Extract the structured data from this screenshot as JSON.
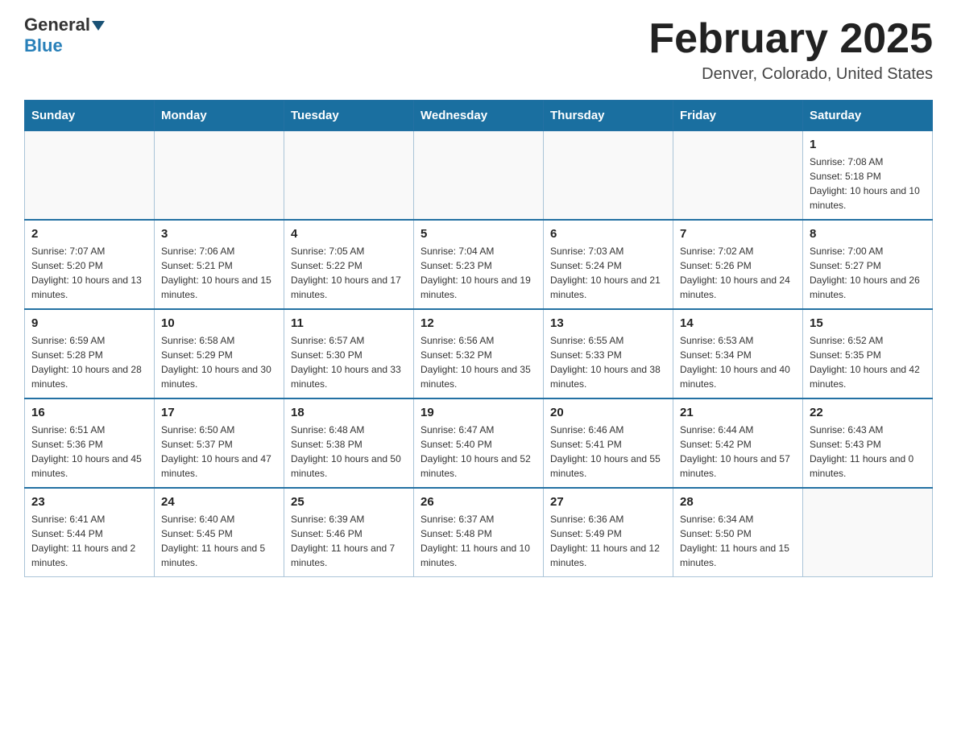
{
  "header": {
    "logo_line1": "General",
    "logo_line2": "Blue",
    "title": "February 2025",
    "subtitle": "Denver, Colorado, United States"
  },
  "days_of_week": [
    "Sunday",
    "Monday",
    "Tuesday",
    "Wednesday",
    "Thursday",
    "Friday",
    "Saturday"
  ],
  "weeks": [
    [
      {
        "day": "",
        "sunrise": "",
        "sunset": "",
        "daylight": ""
      },
      {
        "day": "",
        "sunrise": "",
        "sunset": "",
        "daylight": ""
      },
      {
        "day": "",
        "sunrise": "",
        "sunset": "",
        "daylight": ""
      },
      {
        "day": "",
        "sunrise": "",
        "sunset": "",
        "daylight": ""
      },
      {
        "day": "",
        "sunrise": "",
        "sunset": "",
        "daylight": ""
      },
      {
        "day": "",
        "sunrise": "",
        "sunset": "",
        "daylight": ""
      },
      {
        "day": "1",
        "sunrise": "Sunrise: 7:08 AM",
        "sunset": "Sunset: 5:18 PM",
        "daylight": "Daylight: 10 hours and 10 minutes."
      }
    ],
    [
      {
        "day": "2",
        "sunrise": "Sunrise: 7:07 AM",
        "sunset": "Sunset: 5:20 PM",
        "daylight": "Daylight: 10 hours and 13 minutes."
      },
      {
        "day": "3",
        "sunrise": "Sunrise: 7:06 AM",
        "sunset": "Sunset: 5:21 PM",
        "daylight": "Daylight: 10 hours and 15 minutes."
      },
      {
        "day": "4",
        "sunrise": "Sunrise: 7:05 AM",
        "sunset": "Sunset: 5:22 PM",
        "daylight": "Daylight: 10 hours and 17 minutes."
      },
      {
        "day": "5",
        "sunrise": "Sunrise: 7:04 AM",
        "sunset": "Sunset: 5:23 PM",
        "daylight": "Daylight: 10 hours and 19 minutes."
      },
      {
        "day": "6",
        "sunrise": "Sunrise: 7:03 AM",
        "sunset": "Sunset: 5:24 PM",
        "daylight": "Daylight: 10 hours and 21 minutes."
      },
      {
        "day": "7",
        "sunrise": "Sunrise: 7:02 AM",
        "sunset": "Sunset: 5:26 PM",
        "daylight": "Daylight: 10 hours and 24 minutes."
      },
      {
        "day": "8",
        "sunrise": "Sunrise: 7:00 AM",
        "sunset": "Sunset: 5:27 PM",
        "daylight": "Daylight: 10 hours and 26 minutes."
      }
    ],
    [
      {
        "day": "9",
        "sunrise": "Sunrise: 6:59 AM",
        "sunset": "Sunset: 5:28 PM",
        "daylight": "Daylight: 10 hours and 28 minutes."
      },
      {
        "day": "10",
        "sunrise": "Sunrise: 6:58 AM",
        "sunset": "Sunset: 5:29 PM",
        "daylight": "Daylight: 10 hours and 30 minutes."
      },
      {
        "day": "11",
        "sunrise": "Sunrise: 6:57 AM",
        "sunset": "Sunset: 5:30 PM",
        "daylight": "Daylight: 10 hours and 33 minutes."
      },
      {
        "day": "12",
        "sunrise": "Sunrise: 6:56 AM",
        "sunset": "Sunset: 5:32 PM",
        "daylight": "Daylight: 10 hours and 35 minutes."
      },
      {
        "day": "13",
        "sunrise": "Sunrise: 6:55 AM",
        "sunset": "Sunset: 5:33 PM",
        "daylight": "Daylight: 10 hours and 38 minutes."
      },
      {
        "day": "14",
        "sunrise": "Sunrise: 6:53 AM",
        "sunset": "Sunset: 5:34 PM",
        "daylight": "Daylight: 10 hours and 40 minutes."
      },
      {
        "day": "15",
        "sunrise": "Sunrise: 6:52 AM",
        "sunset": "Sunset: 5:35 PM",
        "daylight": "Daylight: 10 hours and 42 minutes."
      }
    ],
    [
      {
        "day": "16",
        "sunrise": "Sunrise: 6:51 AM",
        "sunset": "Sunset: 5:36 PM",
        "daylight": "Daylight: 10 hours and 45 minutes."
      },
      {
        "day": "17",
        "sunrise": "Sunrise: 6:50 AM",
        "sunset": "Sunset: 5:37 PM",
        "daylight": "Daylight: 10 hours and 47 minutes."
      },
      {
        "day": "18",
        "sunrise": "Sunrise: 6:48 AM",
        "sunset": "Sunset: 5:38 PM",
        "daylight": "Daylight: 10 hours and 50 minutes."
      },
      {
        "day": "19",
        "sunrise": "Sunrise: 6:47 AM",
        "sunset": "Sunset: 5:40 PM",
        "daylight": "Daylight: 10 hours and 52 minutes."
      },
      {
        "day": "20",
        "sunrise": "Sunrise: 6:46 AM",
        "sunset": "Sunset: 5:41 PM",
        "daylight": "Daylight: 10 hours and 55 minutes."
      },
      {
        "day": "21",
        "sunrise": "Sunrise: 6:44 AM",
        "sunset": "Sunset: 5:42 PM",
        "daylight": "Daylight: 10 hours and 57 minutes."
      },
      {
        "day": "22",
        "sunrise": "Sunrise: 6:43 AM",
        "sunset": "Sunset: 5:43 PM",
        "daylight": "Daylight: 11 hours and 0 minutes."
      }
    ],
    [
      {
        "day": "23",
        "sunrise": "Sunrise: 6:41 AM",
        "sunset": "Sunset: 5:44 PM",
        "daylight": "Daylight: 11 hours and 2 minutes."
      },
      {
        "day": "24",
        "sunrise": "Sunrise: 6:40 AM",
        "sunset": "Sunset: 5:45 PM",
        "daylight": "Daylight: 11 hours and 5 minutes."
      },
      {
        "day": "25",
        "sunrise": "Sunrise: 6:39 AM",
        "sunset": "Sunset: 5:46 PM",
        "daylight": "Daylight: 11 hours and 7 minutes."
      },
      {
        "day": "26",
        "sunrise": "Sunrise: 6:37 AM",
        "sunset": "Sunset: 5:48 PM",
        "daylight": "Daylight: 11 hours and 10 minutes."
      },
      {
        "day": "27",
        "sunrise": "Sunrise: 6:36 AM",
        "sunset": "Sunset: 5:49 PM",
        "daylight": "Daylight: 11 hours and 12 minutes."
      },
      {
        "day": "28",
        "sunrise": "Sunrise: 6:34 AM",
        "sunset": "Sunset: 5:50 PM",
        "daylight": "Daylight: 11 hours and 15 minutes."
      },
      {
        "day": "",
        "sunrise": "",
        "sunset": "",
        "daylight": ""
      }
    ]
  ]
}
